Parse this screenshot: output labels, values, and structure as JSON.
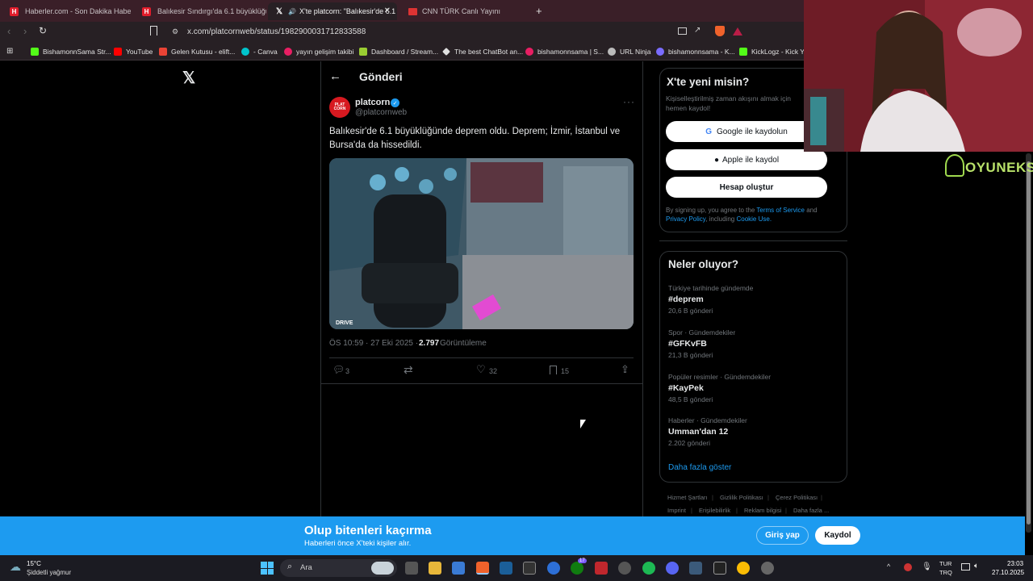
{
  "browser": {
    "tabs": [
      {
        "label": "Haberler.com - Son Dakika Haberler"
      },
      {
        "label": "Balıkesir Sındırgı'da 6.1 büyüklüğünd"
      },
      {
        "label": "X'te platcorn: \"Balıkesir'de 6.1"
      },
      {
        "label": "CNN TÜRK Canlı Yayını"
      }
    ],
    "new_tab": "+",
    "url": "x.com/platcornweb/status/1982900031712833588",
    "bookmarks": [
      "BishamonnSama Str...",
      "YouTube",
      "Gelen Kutusu - elift...",
      "- Canva",
      "yayın gelişim takibi",
      "Dashboard / Stream...",
      "The best ChatBot an...",
      "bishamonnsama | S...",
      "URL Ninja",
      "bishamonnsama - K...",
      "KickLogz - Kick Yay"
    ]
  },
  "post": {
    "header_title": "Gönderi",
    "author_name": "platcorn",
    "author_handle": "@platcornweb",
    "avatar_text": "PLAT CORN",
    "text_line1": "Balıkesir'de 6.1 büyüklüğünde deprem oldu. Deprem; İzmir, İstanbul ve",
    "text_line2": "Bursa'da da hissedildi.",
    "timestamp": "ÖS 10:59 · 27 Eki 2025 ·",
    "views_count": "2.797",
    "views_label": "Görüntüleme",
    "media_watermark": "DRIVE",
    "actions": {
      "replies": "3",
      "likes": "32",
      "bookmarks": "15"
    }
  },
  "signup": {
    "title": "X'te yeni misin?",
    "subtitle": "Kişiselleştirilmiş zaman akışını almak için hemen kaydol!",
    "google_btn": "Google ile kaydolun",
    "apple_btn": "Apple ile kaydol",
    "create_btn": "Hesap oluştur",
    "terms_pre": "By signing up, you agree to the",
    "terms_link": "Terms of Service",
    "terms_and": "and",
    "privacy_link": "Privacy Policy",
    "including": ", including",
    "cookie_link": "Cookie Use."
  },
  "trends": {
    "title": "Neler oluyor?",
    "items": [
      {
        "category": "Türkiye tarihinde gündemde",
        "name": "#deprem",
        "count": "20,6 B gönderi"
      },
      {
        "category": "Spor · Gündemdekiler",
        "name": "#GFKvFB",
        "count": "21,3 B gönderi"
      },
      {
        "category": "Popüler resimler · Gündemdekiler",
        "name": "#KayPek",
        "count": "48,5 B gönderi"
      },
      {
        "category": "Haberler · Gündemdekiler",
        "name": "Umman'dan 12",
        "count": "2.202 gönderi"
      }
    ],
    "show_more": "Daha fazla göster"
  },
  "footer_links": [
    "Hizmet Şartları",
    "Gizlilik Politikası",
    "Çerez Politikası",
    "Imprint",
    "Erişilebilirlik",
    "Reklam bilgisi",
    "Daha fazla ..."
  ],
  "banner": {
    "title": "Olup bitenleri kaçırma",
    "subtitle": "Haberleri önce X'teki kişiler alır.",
    "login_btn": "Giriş yap",
    "signup_btn": "Kaydol"
  },
  "overlay": {
    "brand": "OYUNEKS"
  },
  "taskbar": {
    "weather_temp": "15°C",
    "weather_desc": "Şiddetli yağmur",
    "search_placeholder": "Ara",
    "lang_top": "TUR",
    "lang_bottom": "TRQ",
    "time": "23:03",
    "date": "27.10.2025",
    "badge": "17"
  },
  "colors": {
    "accent": "#1d9bf0",
    "brand_red": "#e11d2b",
    "tab_strip": "#3a1f28"
  }
}
